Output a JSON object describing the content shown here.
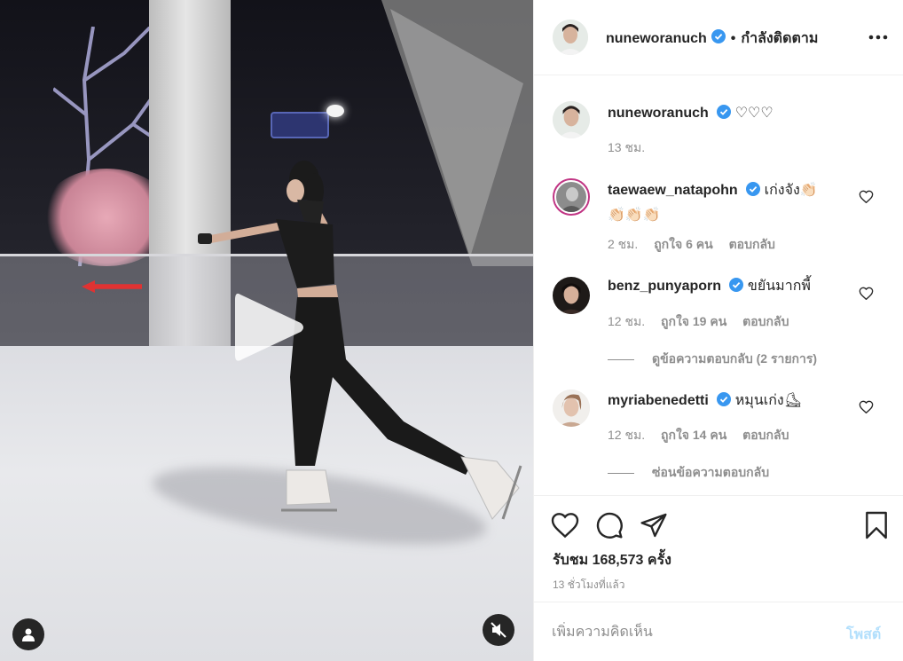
{
  "header": {
    "username": "nuneworanuch",
    "separator": "•",
    "follow_status": "กำลังติดตาม"
  },
  "caption": {
    "username": "nuneworanuch",
    "text": "♡♡♡",
    "time": "13 ชม."
  },
  "comments": [
    {
      "username": "taewaew_natapohn",
      "text_line1": "เก่งจัง👏🏻",
      "text_line2": "👏🏻👏🏻👏🏻",
      "time": "2 ชม.",
      "likes": "ถูกใจ 6 คน",
      "reply": "ตอบกลับ"
    },
    {
      "username": "benz_punyaporn",
      "text": "ขยันมากพี้",
      "time": "12 ชม.",
      "likes": "ถูกใจ 19 คน",
      "reply": "ตอบกลับ",
      "view_replies": "ดูข้อความตอบกลับ (2 รายการ)"
    },
    {
      "username": "myriabenedetti",
      "text": "หมุนเก่ง⛸",
      "time": "12 ชม.",
      "likes": "ถูกใจ 14 คน",
      "reply": "ตอบกลับ",
      "hide_replies": "ซ่อนข้อความตอบกลับ"
    }
  ],
  "stats": {
    "views": "รับชม 168,573 ครั้ง",
    "time_ago": "13 ชั่วโมงที่แล้ว"
  },
  "comment_box": {
    "placeholder": "เพิ่มความคิดเห็น",
    "post_label": "โพสต์"
  },
  "colors": {
    "text": "#262626",
    "muted": "#8e8e8e",
    "verified": "#3897f0",
    "post_disabled": "#b2dffc",
    "divider": "#efefef"
  },
  "icons": [
    "verified-icon",
    "more-options-icon",
    "heart-icon",
    "comment-icon",
    "share-icon",
    "bookmark-icon",
    "play-icon",
    "user-tag-icon",
    "muted-speaker-icon"
  ]
}
